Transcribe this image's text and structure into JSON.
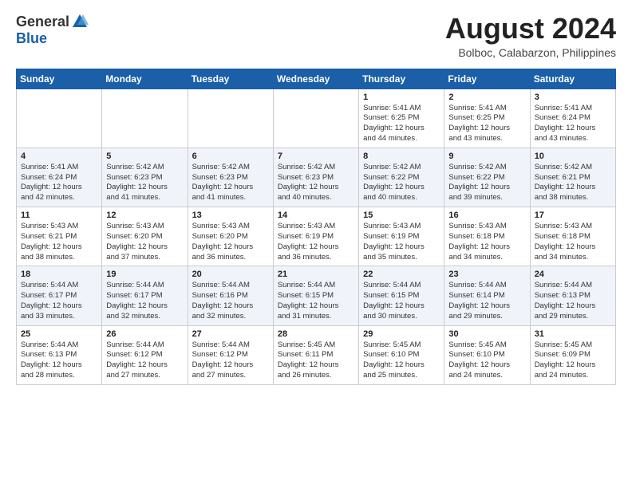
{
  "header": {
    "logo_general": "General",
    "logo_blue": "Blue",
    "title": "August 2024",
    "location": "Bolboc, Calabarzon, Philippines"
  },
  "weekdays": [
    "Sunday",
    "Monday",
    "Tuesday",
    "Wednesday",
    "Thursday",
    "Friday",
    "Saturday"
  ],
  "weeks": [
    [
      {
        "day": "",
        "info": ""
      },
      {
        "day": "",
        "info": ""
      },
      {
        "day": "",
        "info": ""
      },
      {
        "day": "",
        "info": ""
      },
      {
        "day": "1",
        "info": "Sunrise: 5:41 AM\nSunset: 6:25 PM\nDaylight: 12 hours\nand 44 minutes."
      },
      {
        "day": "2",
        "info": "Sunrise: 5:41 AM\nSunset: 6:25 PM\nDaylight: 12 hours\nand 43 minutes."
      },
      {
        "day": "3",
        "info": "Sunrise: 5:41 AM\nSunset: 6:24 PM\nDaylight: 12 hours\nand 43 minutes."
      }
    ],
    [
      {
        "day": "4",
        "info": "Sunrise: 5:41 AM\nSunset: 6:24 PM\nDaylight: 12 hours\nand 42 minutes."
      },
      {
        "day": "5",
        "info": "Sunrise: 5:42 AM\nSunset: 6:23 PM\nDaylight: 12 hours\nand 41 minutes."
      },
      {
        "day": "6",
        "info": "Sunrise: 5:42 AM\nSunset: 6:23 PM\nDaylight: 12 hours\nand 41 minutes."
      },
      {
        "day": "7",
        "info": "Sunrise: 5:42 AM\nSunset: 6:23 PM\nDaylight: 12 hours\nand 40 minutes."
      },
      {
        "day": "8",
        "info": "Sunrise: 5:42 AM\nSunset: 6:22 PM\nDaylight: 12 hours\nand 40 minutes."
      },
      {
        "day": "9",
        "info": "Sunrise: 5:42 AM\nSunset: 6:22 PM\nDaylight: 12 hours\nand 39 minutes."
      },
      {
        "day": "10",
        "info": "Sunrise: 5:42 AM\nSunset: 6:21 PM\nDaylight: 12 hours\nand 38 minutes."
      }
    ],
    [
      {
        "day": "11",
        "info": "Sunrise: 5:43 AM\nSunset: 6:21 PM\nDaylight: 12 hours\nand 38 minutes."
      },
      {
        "day": "12",
        "info": "Sunrise: 5:43 AM\nSunset: 6:20 PM\nDaylight: 12 hours\nand 37 minutes."
      },
      {
        "day": "13",
        "info": "Sunrise: 5:43 AM\nSunset: 6:20 PM\nDaylight: 12 hours\nand 36 minutes."
      },
      {
        "day": "14",
        "info": "Sunrise: 5:43 AM\nSunset: 6:19 PM\nDaylight: 12 hours\nand 36 minutes."
      },
      {
        "day": "15",
        "info": "Sunrise: 5:43 AM\nSunset: 6:19 PM\nDaylight: 12 hours\nand 35 minutes."
      },
      {
        "day": "16",
        "info": "Sunrise: 5:43 AM\nSunset: 6:18 PM\nDaylight: 12 hours\nand 34 minutes."
      },
      {
        "day": "17",
        "info": "Sunrise: 5:43 AM\nSunset: 6:18 PM\nDaylight: 12 hours\nand 34 minutes."
      }
    ],
    [
      {
        "day": "18",
        "info": "Sunrise: 5:44 AM\nSunset: 6:17 PM\nDaylight: 12 hours\nand 33 minutes."
      },
      {
        "day": "19",
        "info": "Sunrise: 5:44 AM\nSunset: 6:17 PM\nDaylight: 12 hours\nand 32 minutes."
      },
      {
        "day": "20",
        "info": "Sunrise: 5:44 AM\nSunset: 6:16 PM\nDaylight: 12 hours\nand 32 minutes."
      },
      {
        "day": "21",
        "info": "Sunrise: 5:44 AM\nSunset: 6:15 PM\nDaylight: 12 hours\nand 31 minutes."
      },
      {
        "day": "22",
        "info": "Sunrise: 5:44 AM\nSunset: 6:15 PM\nDaylight: 12 hours\nand 30 minutes."
      },
      {
        "day": "23",
        "info": "Sunrise: 5:44 AM\nSunset: 6:14 PM\nDaylight: 12 hours\nand 29 minutes."
      },
      {
        "day": "24",
        "info": "Sunrise: 5:44 AM\nSunset: 6:13 PM\nDaylight: 12 hours\nand 29 minutes."
      }
    ],
    [
      {
        "day": "25",
        "info": "Sunrise: 5:44 AM\nSunset: 6:13 PM\nDaylight: 12 hours\nand 28 minutes."
      },
      {
        "day": "26",
        "info": "Sunrise: 5:44 AM\nSunset: 6:12 PM\nDaylight: 12 hours\nand 27 minutes."
      },
      {
        "day": "27",
        "info": "Sunrise: 5:44 AM\nSunset: 6:12 PM\nDaylight: 12 hours\nand 27 minutes."
      },
      {
        "day": "28",
        "info": "Sunrise: 5:45 AM\nSunset: 6:11 PM\nDaylight: 12 hours\nand 26 minutes."
      },
      {
        "day": "29",
        "info": "Sunrise: 5:45 AM\nSunset: 6:10 PM\nDaylight: 12 hours\nand 25 minutes."
      },
      {
        "day": "30",
        "info": "Sunrise: 5:45 AM\nSunset: 6:10 PM\nDaylight: 12 hours\nand 24 minutes."
      },
      {
        "day": "31",
        "info": "Sunrise: 5:45 AM\nSunset: 6:09 PM\nDaylight: 12 hours\nand 24 minutes."
      }
    ]
  ]
}
